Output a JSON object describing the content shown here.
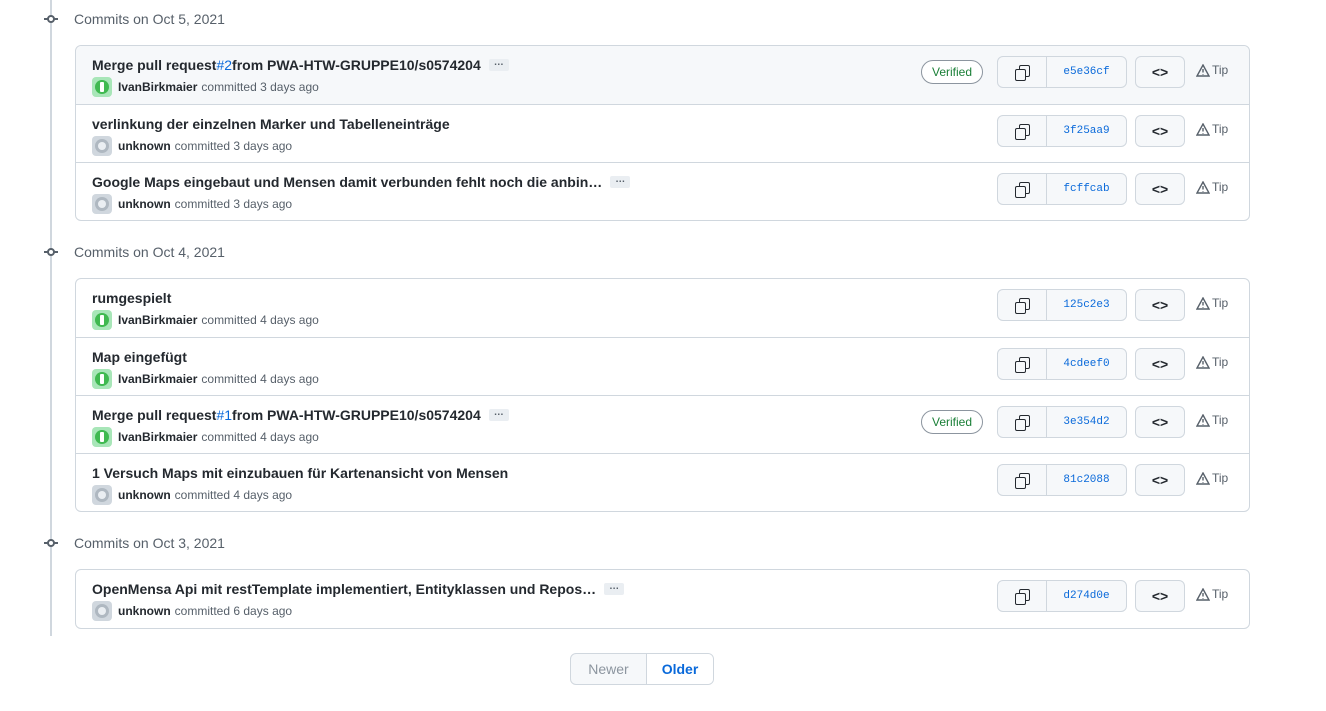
{
  "groups": [
    {
      "title": "Commits on Oct 5, 2021",
      "commits": [
        {
          "title_pre": "Merge pull request ",
          "pr": "#2",
          "title_post": " from PWA-HTW-GRUPPE10/s0574204",
          "ellipsis": "…",
          "author": "IvanBirkmaier",
          "action": "committed",
          "time": "3 days ago",
          "verified": "Verified",
          "sha": "e5e36cf",
          "tip": "Tip",
          "avatar": "green"
        },
        {
          "title_pre": "verlinkung der einzelnen Marker und Tabelleneinträge",
          "pr": "",
          "title_post": "",
          "ellipsis": "",
          "author": "unknown",
          "action": "committed",
          "time": "3 days ago",
          "verified": "",
          "sha": "3f25aa9",
          "tip": "Tip",
          "avatar": "gray"
        },
        {
          "title_pre": "Google Maps eingebaut und Mensen damit verbunden fehlt noch die anbin…",
          "pr": "",
          "title_post": "",
          "ellipsis": "…",
          "author": "unknown",
          "action": "committed",
          "time": "3 days ago",
          "verified": "",
          "sha": "fcffcab",
          "tip": "Tip",
          "avatar": "gray"
        }
      ]
    },
    {
      "title": "Commits on Oct 4, 2021",
      "commits": [
        {
          "title_pre": "rumgespielt",
          "pr": "",
          "title_post": "",
          "ellipsis": "",
          "author": "IvanBirkmaier",
          "action": "committed",
          "time": "4 days ago",
          "verified": "",
          "sha": "125c2e3",
          "tip": "Tip",
          "avatar": "green"
        },
        {
          "title_pre": "Map eingefügt",
          "pr": "",
          "title_post": "",
          "ellipsis": "",
          "author": "IvanBirkmaier",
          "action": "committed",
          "time": "4 days ago",
          "verified": "",
          "sha": "4cdeef0",
          "tip": "Tip",
          "avatar": "green"
        },
        {
          "title_pre": "Merge pull request ",
          "pr": "#1",
          "title_post": " from PWA-HTW-GRUPPE10/s0574204",
          "ellipsis": "…",
          "author": "IvanBirkmaier",
          "action": "committed",
          "time": "4 days ago",
          "verified": "Verified",
          "sha": "3e354d2",
          "tip": "Tip",
          "avatar": "green"
        },
        {
          "title_pre": "1 Versuch Maps mit einzubauen für Kartenansicht von Mensen",
          "pr": "",
          "title_post": "",
          "ellipsis": "",
          "author": "unknown",
          "action": "committed",
          "time": "4 days ago",
          "verified": "",
          "sha": "81c2088",
          "tip": "Tip",
          "avatar": "gray"
        }
      ]
    },
    {
      "title": "Commits on Oct 3, 2021",
      "commits": [
        {
          "title_pre": "OpenMensa Api mit restTemplate implementiert, Entityklassen und Repos…",
          "pr": "",
          "title_post": "",
          "ellipsis": "…",
          "author": "unknown",
          "action": "committed",
          "time": "6 days ago",
          "verified": "",
          "sha": "d274d0e",
          "tip": "Tip",
          "avatar": "gray"
        }
      ]
    }
  ],
  "pagination": {
    "newer": "Newer",
    "older": "Older"
  },
  "icons": {
    "copy": "copy-icon",
    "browse": "code-icon",
    "tip": "alert-icon",
    "node": "commit-node-icon"
  },
  "colors": {
    "link": "#0969da",
    "verified": "#1a7f37",
    "muted": "#57606a",
    "border": "#d0d7de"
  }
}
